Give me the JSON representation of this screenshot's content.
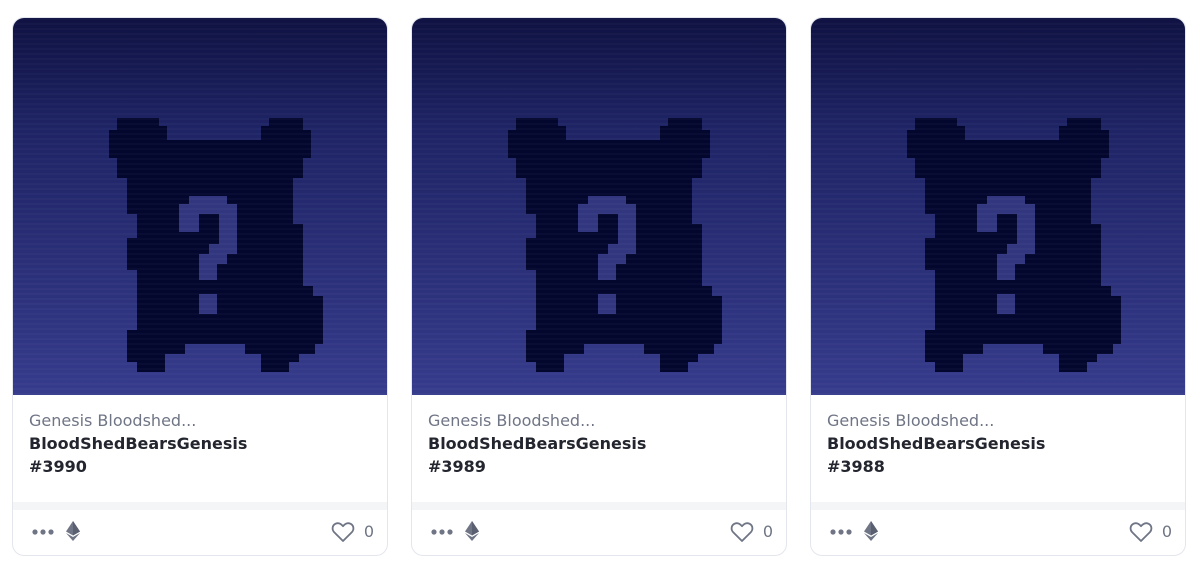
{
  "cards": [
    {
      "collection": "Genesis Bloodshed...",
      "name": "BloodShedBearsGenesis",
      "token": "#3990",
      "likes": "0"
    },
    {
      "collection": "Genesis Bloodshed...",
      "name": "BloodShedBearsGenesis",
      "token": "#3989",
      "likes": "0"
    },
    {
      "collection": "Genesis Bloodshed...",
      "name": "BloodShedBearsGenesis",
      "token": "#3988",
      "likes": "0"
    }
  ],
  "icons": {
    "more": "more-options-icon",
    "chain": "ethereum-icon",
    "like": "heart-icon"
  },
  "colors": {
    "art_top": "#0f1242",
    "art_bottom": "#363b8c",
    "bear": "#03072e",
    "question_mark": "#32367e",
    "muted_text": "#6f7585",
    "title_text": "#24262f"
  }
}
